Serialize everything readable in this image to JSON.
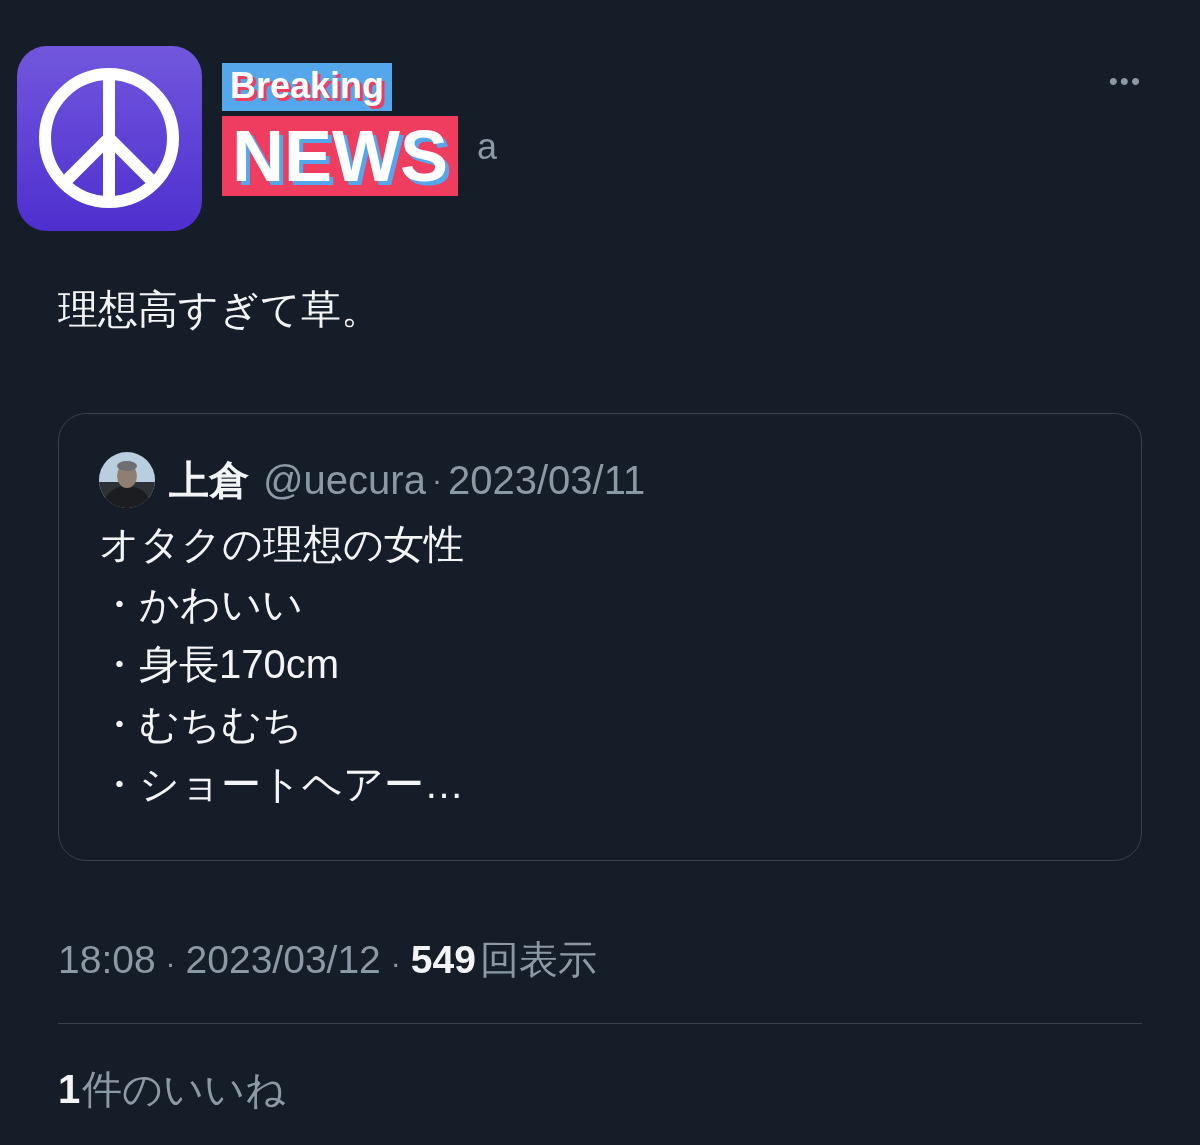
{
  "post": {
    "handle_fragment": "a",
    "text": "理想高すぎて草。"
  },
  "sticker": {
    "top": "Breaking",
    "bottom": "NEWS"
  },
  "more_menu": "•••",
  "quote": {
    "name": "上倉",
    "handle": "@uecura",
    "separator": "·",
    "date": "2023/03/11",
    "lines": [
      "オタクの理想の女性",
      "・かわいい",
      "・身長170cm",
      "・むちむち",
      "・ショートヘアー…"
    ]
  },
  "meta": {
    "time": "18:08",
    "separator_1": "·",
    "date": "2023/03/12",
    "separator_2": "·",
    "views_count": "549",
    "views_label": "回表示"
  },
  "likes": {
    "count": "1",
    "label": "件のいいね"
  }
}
